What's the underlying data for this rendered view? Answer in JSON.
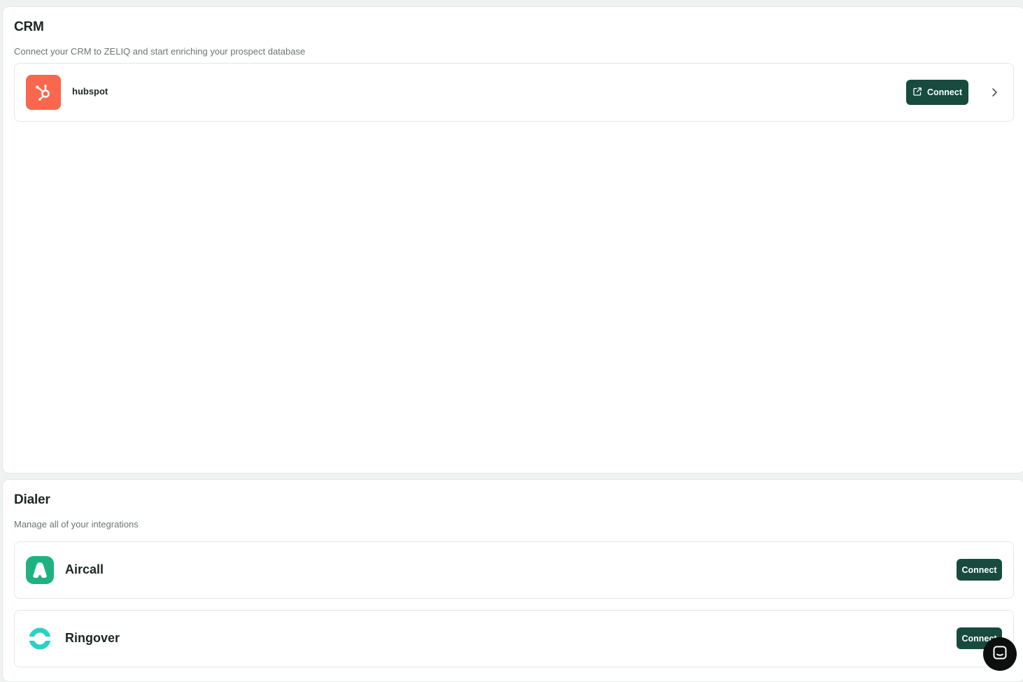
{
  "crm": {
    "title": "CRM",
    "subtitle": "Connect your CRM to ZELIQ and start enriching your prospect database",
    "integrations": [
      {
        "name": "hubspot",
        "logo_icon": "hubspot-icon",
        "logo_color": "#f8674e",
        "button_label": "Connect",
        "button_icon": "external-link-icon"
      }
    ]
  },
  "dialer": {
    "title": "Dialer",
    "subtitle": "Manage all of your integrations",
    "integrations": [
      {
        "name": "Aircall",
        "logo_icon": "aircall-icon",
        "logo_color": "#1db27f",
        "button_label": "Connect"
      },
      {
        "name": "Ringover",
        "logo_icon": "ringover-icon",
        "logo_color": "#27d3c2",
        "button_label": "Connect"
      }
    ]
  },
  "colors": {
    "button_bg": "#174b3f",
    "page_bg": "#eef2f0",
    "chat_launcher_bg": "#0d0f0f"
  },
  "chat_launcher": {
    "icon": "chat-icon"
  }
}
